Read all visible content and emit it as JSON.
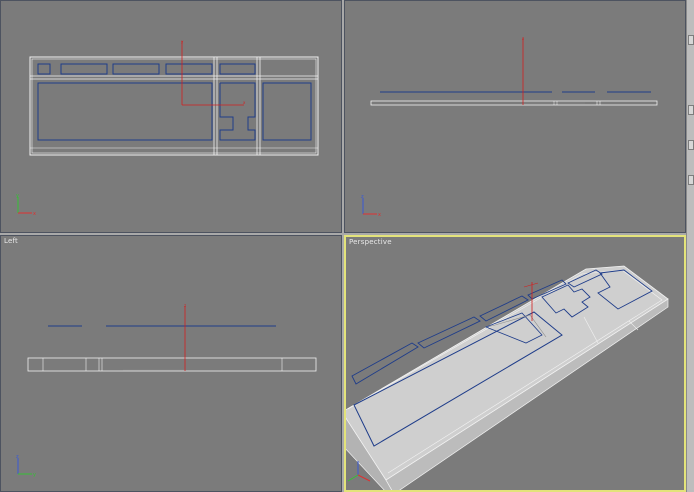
{
  "viewports": {
    "top": {
      "label": ""
    },
    "front": {
      "label": ""
    },
    "left": {
      "label": "Left"
    },
    "perspective": {
      "label": "Perspective"
    }
  },
  "colors": {
    "viewport_bg": "#7b7b7b",
    "frame": "#5b6170",
    "active_border": "#e3e37a",
    "wire_white": "#f2f2f2",
    "wire_blue": "#1f3d8a",
    "pivot_red": "#d41f1f",
    "shaded_top": "#cfcfcf",
    "shaded_side": "#b9b9b9"
  },
  "axis_icons": [
    "axis-tripod-icon"
  ]
}
